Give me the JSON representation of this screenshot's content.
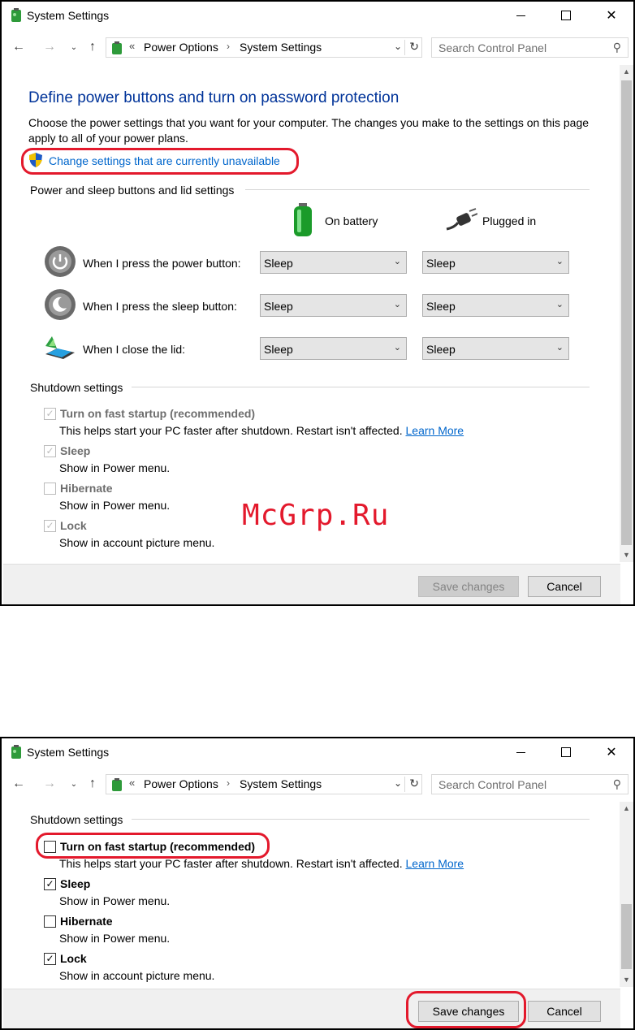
{
  "window": {
    "title": "System Settings",
    "controls": {
      "minimize": "minimize-icon",
      "maximize": "maximize-icon",
      "close": "close-icon",
      "close_glyph": "✕"
    }
  },
  "nav": {
    "back": "←",
    "forward": "→",
    "recent": "⌄",
    "up": "↑",
    "address_sep": "«",
    "breadcrumbs": [
      "Power Options",
      "System Settings"
    ],
    "crumb_arrow": "›",
    "dropdown": "⌄",
    "refresh": "↻",
    "search_placeholder": "Search Control Panel",
    "search_glyph": "⚲"
  },
  "page": {
    "heading": "Define power buttons and turn on password protection",
    "description": "Choose the power settings that you want for your computer. The changes you make to the settings on this page apply to all of your power plans.",
    "admin_link": "Change settings that are currently unavailable",
    "power_section": "Power and sleep buttons and lid settings",
    "columns": {
      "battery": "On battery",
      "plugged": "Plugged in"
    },
    "rows": [
      {
        "label": "When I press the power button:",
        "battery": "Sleep",
        "plugged": "Sleep"
      },
      {
        "label": "When I press the sleep button:",
        "battery": "Sleep",
        "plugged": "Sleep"
      },
      {
        "label": "When I close the lid:",
        "battery": "Sleep",
        "plugged": "Sleep"
      }
    ],
    "shutdown_section": "Shutdown settings",
    "shutdown": {
      "fast_startup": {
        "label": "Turn on fast startup (recommended)",
        "desc": "This helps start your PC faster after shutdown. Restart isn't affected.",
        "link": "Learn More"
      },
      "sleep": {
        "label": "Sleep",
        "desc": "Show in Power menu."
      },
      "hibernate": {
        "label": "Hibernate",
        "desc": "Show in Power menu."
      },
      "lock": {
        "label": "Lock",
        "desc": "Show in account picture menu."
      }
    },
    "check_glyph": "✓",
    "chevron_glyph": "⌄"
  },
  "state_before": {
    "fast_startup": true,
    "sleep": true,
    "hibernate": false,
    "lock": true,
    "enabled": false
  },
  "state_after": {
    "fast_startup": false,
    "sleep": true,
    "hibernate": false,
    "lock": true,
    "enabled": true
  },
  "buttons": {
    "save": "Save changes",
    "cancel": "Cancel"
  },
  "scroll": {
    "up": "▲",
    "down": "▼"
  },
  "watermark": "McGrp.Ru",
  "colors": {
    "heading": "#003399",
    "link": "#0066cc",
    "highlight": "#e3192c"
  }
}
